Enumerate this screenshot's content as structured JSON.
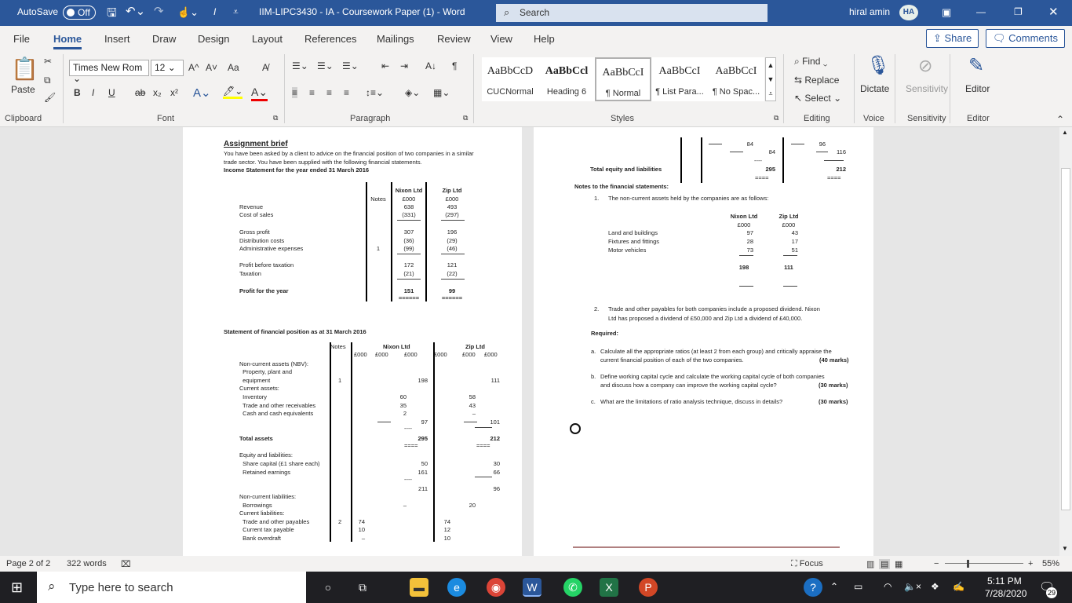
{
  "titlebar": {
    "autosave": "AutoSave",
    "toggle": "Off",
    "title": "IIM-LIPC3430 - IA - Coursework Paper (1)  -  Word",
    "search": "Search",
    "user": "hiral amin",
    "initials": "HA"
  },
  "tabs": [
    "File",
    "Home",
    "Insert",
    "Draw",
    "Design",
    "Layout",
    "References",
    "Mailings",
    "Review",
    "View",
    "Help"
  ],
  "share": "Share",
  "comments": "Comments",
  "ribbon": {
    "clipboard": {
      "paste": "Paste",
      "label": "Clipboard"
    },
    "font": {
      "name": "Times New Rom",
      "size": "12",
      "label": "Font",
      "grow": "A^",
      "shrink": "A˅",
      "case": "Aa",
      "bold": "B",
      "italic": "I",
      "underline": "U",
      "strike": "ab",
      "sub": "x₂",
      "sup": "x²"
    },
    "paragraph": {
      "label": "Paragraph"
    },
    "styles": {
      "label": "Styles",
      "items": [
        {
          "preview": "AaBbCcD",
          "name": "CUCNormal"
        },
        {
          "preview": "AaBbCcl",
          "name": "Heading 6"
        },
        {
          "preview": "AaBbCcI",
          "name": "¶ Normal"
        },
        {
          "preview": "AaBbCcI",
          "name": "¶ List Para..."
        },
        {
          "preview": "AaBbCcI",
          "name": "¶ No Spac..."
        }
      ]
    },
    "editing": {
      "label": "Editing",
      "find": "Find",
      "replace": "Replace",
      "select": "Select"
    },
    "voice": {
      "label": "Voice",
      "dictate": "Dictate"
    },
    "sensitivity": {
      "label": "Sensitivity",
      "button": "Sensitivity"
    },
    "editor": {
      "label": "Editor",
      "button": "Editor"
    }
  },
  "doc": {
    "heading": "Assignment brief",
    "intro": [
      "You have been asked by a client to advice on the financial position of two companies in a similar",
      "trade sector. You have been supplied with the following financial statements."
    ],
    "income_title": "Income Statement for the year ended 31 March 2016",
    "income": {
      "notes": "Notes",
      "nixon": "Nixon Ltd",
      "zip": "Zip Ltd",
      "unit": "£000",
      "rows": [
        {
          "label": "Revenue",
          "note": "",
          "nixon": "638",
          "zip": "493"
        },
        {
          "label": "Cost of sales",
          "note": "",
          "nixon": "(331)",
          "zip": "(297)"
        },
        {
          "label": "Gross profit",
          "note": "",
          "nixon": "307",
          "zip": "196"
        },
        {
          "label": "Distribution costs",
          "note": "",
          "nixon": "(36)",
          "zip": "(29)"
        },
        {
          "label": "Administrative expenses",
          "note": "1",
          "nixon": "(99)",
          "zip": "(46)"
        },
        {
          "label": "Profit before taxation",
          "note": "",
          "nixon": "172",
          "zip": "121"
        },
        {
          "label": "Taxation",
          "note": "",
          "nixon": "(21)",
          "zip": "(22)"
        },
        {
          "label": "Profit for the year",
          "note": "",
          "nixon": "151",
          "zip": "99"
        }
      ],
      "double": "======"
    },
    "sfp_title": "Statement of financial position as at 31 March 2016",
    "sfp": {
      "notes": "Notes",
      "nixon": "Nixon Ltd",
      "zip": "Zip Ltd",
      "unit": "£000",
      "rows": [
        {
          "label": "Non-current assets (NBV):",
          "note": "",
          "c1": "",
          "c2": "",
          "c3": "",
          "z1": "",
          "z2": "",
          "z3": ""
        },
        {
          "label": "  Property, plant and",
          "note": "",
          "c1": "",
          "c2": "",
          "c3": "",
          "z1": "",
          "z2": "",
          "z3": ""
        },
        {
          "label": "  equipment",
          "note": "1",
          "c1": "",
          "c2": "",
          "c3": "198",
          "z1": "",
          "z2": "",
          "z3": "111"
        },
        {
          "label": "Current assets:",
          "note": "",
          "c1": "",
          "c2": "",
          "c3": "",
          "z1": "",
          "z2": "",
          "z3": ""
        },
        {
          "label": "  Inventory",
          "note": "",
          "c1": "",
          "c2": "60",
          "c3": "",
          "z1": "",
          "z2": "58",
          "z3": ""
        },
        {
          "label": "  Trade and other receivables",
          "note": "",
          "c1": "",
          "c2": "35",
          "c3": "",
          "z1": "",
          "z2": "43",
          "z3": ""
        },
        {
          "label": "  Cash and cash equivalents",
          "note": "",
          "c1": "",
          "c2": "2",
          "c3": "",
          "z1": "",
          "z2": "–",
          "z3": ""
        },
        {
          "label": "",
          "note": "",
          "c1": "",
          "c2": "",
          "c3": "97",
          "z1": "",
          "z2": "",
          "z3": "101"
        },
        {
          "label": "Total assets",
          "note": "",
          "c1": "",
          "c2": "",
          "c3": "295",
          "z1": "",
          "z2": "",
          "z3": "212"
        },
        {
          "label": "Equity and liabilities:",
          "note": "",
          "c1": "",
          "c2": "",
          "c3": "",
          "z1": "",
          "z2": "",
          "z3": ""
        },
        {
          "label": "  Share capital (£1 share each)",
          "note": "",
          "c1": "",
          "c2": "",
          "c3": "50",
          "z1": "",
          "z2": "",
          "z3": "30"
        },
        {
          "label": "  Retained earnings",
          "note": "",
          "c1": "",
          "c2": "",
          "c3": "161",
          "z1": "",
          "z2": "",
          "z3": "66"
        },
        {
          "label": "",
          "note": "",
          "c1": "",
          "c2": "",
          "c3": "211",
          "z1": "",
          "z2": "",
          "z3": "96"
        },
        {
          "label": "Non-current liabilities:",
          "note": "",
          "c1": "",
          "c2": "",
          "c3": "",
          "z1": "",
          "z2": "",
          "z3": ""
        },
        {
          "label": "  Borrowings",
          "note": "",
          "c1": "",
          "c2": "–",
          "c3": "",
          "z1": "",
          "z2": "20",
          "z3": ""
        },
        {
          "label": "Current liabilities:",
          "note": "",
          "c1": "",
          "c2": "",
          "c3": "",
          "z1": "",
          "z2": "",
          "z3": ""
        },
        {
          "label": "  Trade and other payables",
          "note": "2",
          "c1": "74",
          "c2": "",
          "c3": "",
          "z1": "74",
          "z2": "",
          "z3": ""
        },
        {
          "label": "  Current tax payable",
          "note": "",
          "c1": "10",
          "c2": "",
          "c3": "",
          "z1": "12",
          "z2": "",
          "z3": ""
        },
        {
          "label": "  Bank overdraft",
          "note": "",
          "c1": "–",
          "c2": "",
          "c3": "",
          "z1": "10",
          "z2": "",
          "z3": ""
        }
      ],
      "dashes": "----",
      "double": "===="
    },
    "p2": {
      "sub1": {
        "nixon": "84",
        "zip": "96"
      },
      "sub2": {
        "nixon": "84",
        "zip": "116"
      },
      "total_label": "Total equity and liabilities",
      "total": {
        "nixon": "295",
        "zip": "212"
      },
      "notes_title": "Notes to the financial statements:",
      "note1_num": "1.",
      "note1": "The non-current assets held by the companies are as follows:",
      "nca": {
        "nixon": "Nixon Ltd",
        "zip": "Zip Ltd",
        "unit": "£000",
        "rows": [
          {
            "label": "Land and buildings",
            "nixon": "97",
            "zip": "43"
          },
          {
            "label": "Fixtures and fittings",
            "nixon": "28",
            "zip": "17"
          },
          {
            "label": "Motor vehicles",
            "nixon": "73",
            "zip": "51"
          }
        ],
        "total": {
          "nixon": "198",
          "zip": "111"
        }
      },
      "note2_num": "2.",
      "note2": [
        "Trade and other payables for both companies include a proposed dividend. Nixon",
        "Ltd has proposed a dividend of £50,000 and Zip Ltd a dividend of £40,000."
      ],
      "required": "Required:",
      "questions": [
        {
          "letter": "a.",
          "lines": [
            "Calculate all the appropriate ratios (at least 2 from each group) and critically appraise the",
            "current financial position of each of the two companies."
          ],
          "marks": "(40 marks)"
        },
        {
          "letter": "b.",
          "lines": [
            "Define working capital cycle and calculate the working capital cycle of both companies",
            "and discuss how a company can improve the working capital cycle?"
          ],
          "marks": "(30 marks)"
        },
        {
          "letter": "c.",
          "lines": [
            "What are the limitations of ratio analysis technique, discuss in details?"
          ],
          "marks": "(30 marks)"
        }
      ]
    }
  },
  "status": {
    "page": "Page 2 of 2",
    "words": "322 words",
    "focus": "Focus",
    "zoom": "55%",
    "zoom_value": 55
  },
  "taskbar": {
    "search": "Type here to search",
    "time": "5:11 PM",
    "date": "7/28/2020",
    "notifications": "29"
  },
  "colors": {
    "word_blue": "#2b579a"
  }
}
